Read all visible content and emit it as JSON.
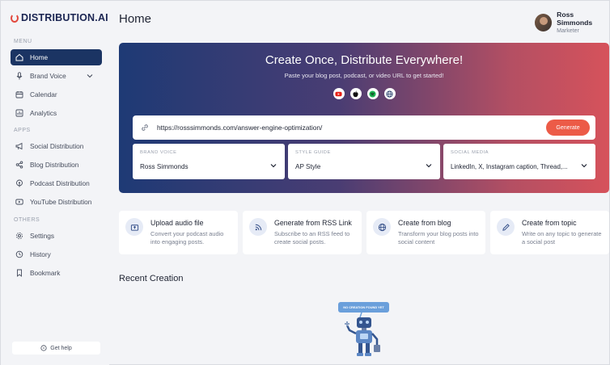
{
  "brand": {
    "name": "DISTRIBUTION.AI"
  },
  "sidebar": {
    "menu_label": "MENU",
    "apps_label": "APPS",
    "others_label": "OTHERS",
    "menu": [
      {
        "label": "Home",
        "icon": "home-icon",
        "active": true
      },
      {
        "label": "Brand Voice",
        "icon": "microphone-icon"
      },
      {
        "label": "Calendar",
        "icon": "calendar-icon"
      },
      {
        "label": "Analytics",
        "icon": "analytics-icon"
      }
    ],
    "apps": [
      {
        "label": "Social Distribution",
        "icon": "megaphone-icon"
      },
      {
        "label": "Blog Distribution",
        "icon": "share-icon"
      },
      {
        "label": "Podcast Distribution",
        "icon": "podcast-icon"
      },
      {
        "label": "YouTube Distribution",
        "icon": "youtube-icon"
      }
    ],
    "others": [
      {
        "label": "Settings",
        "icon": "gear-icon"
      },
      {
        "label": "History",
        "icon": "history-icon"
      },
      {
        "label": "Bookmark",
        "icon": "bookmark-icon"
      }
    ],
    "help": "Get help"
  },
  "header": {
    "title": "Home"
  },
  "user": {
    "name": "Ross Simmonds",
    "role": "Marketer"
  },
  "hero": {
    "title": "Create Once, Distribute Everywhere!",
    "subtitle": "Paste your blog post, podcast, or video URL to get started!",
    "platform_icons": [
      "youtube-icon",
      "apple-icon",
      "spotify-icon",
      "globe-icon"
    ],
    "url_value": "https://rosssimmonds.com/answer-engine-optimization/",
    "generate_label": "Generate",
    "selects": [
      {
        "label": "BRAND VOICE",
        "value": "Ross Simmonds"
      },
      {
        "label": "STYLE GUIDE",
        "value": "AP Style"
      },
      {
        "label": "SOCIAL MEDIA",
        "value": "LinkedIn, X, Instagram caption, Thread,..."
      }
    ]
  },
  "actions": [
    {
      "title": "Upload audio file",
      "desc": "Convert your podcast audio into engaging posts.",
      "icon": "upload-audio-icon"
    },
    {
      "title": "Generate from RSS Link",
      "desc": "Subscribe to an RSS feed to create social posts.",
      "icon": "rss-icon"
    },
    {
      "title": "Create from blog",
      "desc": "Transform your blog posts into social content",
      "icon": "globe-icon"
    },
    {
      "title": "Create from topic",
      "desc": "Write on any topic to generate a social post",
      "icon": "pencil-icon"
    }
  ],
  "recent": {
    "title": "Recent Creation",
    "empty_text": "NO CREATION FOUND YET"
  },
  "colors": {
    "accent": "#1b3463",
    "generate": "#ec5b47",
    "hero_start": "#1e3a75",
    "hero_end": "#d6525b"
  }
}
